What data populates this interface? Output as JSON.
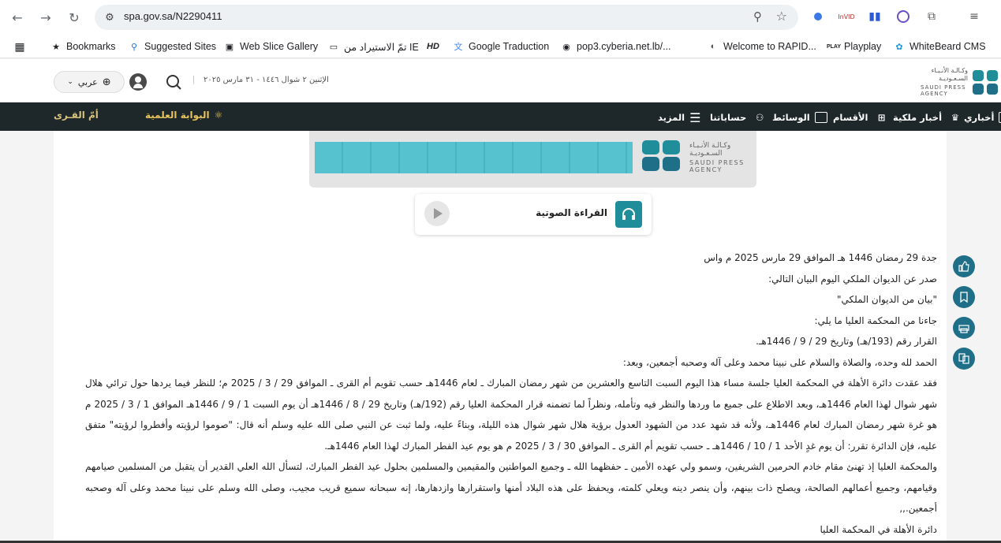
{
  "browser": {
    "url": "spa.gov.sa/N2290411",
    "bookmarks": [
      {
        "label": "Bookmarks",
        "icon": "star-icon"
      },
      {
        "label": "Suggested Sites",
        "icon": "search-icon"
      },
      {
        "label": "Web Slice Gallery",
        "icon": "web-slice-icon"
      },
      {
        "label": "تمّ الاستيراد من IE",
        "icon": "folder-icon"
      },
      {
        "label": "HD",
        "icon": "hd-icon"
      },
      {
        "label": "Google Traduction",
        "icon": "translate-icon"
      },
      {
        "label": "pop3.cyberia.net.lb/...",
        "icon": "globe-icon"
      },
      {
        "label": "Welcome to RAPID...",
        "icon": "rapid-icon"
      },
      {
        "label": "Playplay",
        "icon": "playplay-icon"
      },
      {
        "label": "WhiteBeard CMS",
        "icon": "whitebeard-icon"
      }
    ]
  },
  "header": {
    "language": "عربي",
    "date": "الإثنين ٢ شوال ١٤٤٦ - ٣١ مارس ٢٠٢٥",
    "logo_ar": "وكـالـة الأنـبـاء السـعـوديـة",
    "logo_en": "SAUDI PRESS AGENCY"
  },
  "nav": {
    "items": [
      {
        "label": "أخباري"
      },
      {
        "label": "أخبار ملكية"
      },
      {
        "label": "الأقسام"
      },
      {
        "label": "الوسائط"
      },
      {
        "label": "حساباتنا"
      },
      {
        "label": "المزيد"
      }
    ],
    "science_portal": "البوابة العلمية",
    "umm_al_qura": "أمّ القـرى"
  },
  "audio": {
    "label": "القراءة الصوتية"
  },
  "article": {
    "lines": [
      "جدة 29 رمضان 1446 هـ الموافق 29 مارس 2025 م واس",
      "صدر عن الديوان الملكي اليوم البيان التالي:",
      "\"بيان من الديوان الملكي\"",
      "جاءنا من المحكمة العليا ما يلي:",
      "القرار رقم (193/هـ) وتاريخ 29 / 9 / 1446هـ.",
      "الحمد لله وحده، والصلاة والسلام على نبينا محمد وعلى آله وصحبه أجمعين، وبعد:",
      "فقد عقدت دائرة الأهلة في المحكمة العليا جلسة مساء هذا اليوم السبت التاسع والعشرين من شهر رمضان المبارك ـ لعام 1446هـ حسب تقويم أم القرى ـ الموافق 29 / 3 / 2025 م؛ للنظر فيما يردها حول ترائي هلال شهر شوال لهذا العام 1446هـ، وبعد الاطلاع على جميع ما وردها والنظر فيه وتأمله، ونظراً لما تضمنه قرار المحكمة العليا رقم (192/هـ) وتاريخ 29 / 8 / 1446هـ أن يوم السبت 1 / 9 / 1446هـ الموافق 1 / 3 / 2025 م هو غرة شهر رمضان المبارك لعام 1446هـ، ولأنه قد شهد عدد من الشهود العدول برؤية هلال شهر شوال هذه الليلة، وبناءً عليه، ولما ثبت عن النبي صلى الله عليه وسلم أنه قال: \"صوموا لرؤيته وأفطروا لرؤيته\" متفق عليه، فإن الدائرة تقرر: أن يوم غدٍ الأحد 1 / 10 / 1446هـ ـ حسب تقويم أم القرى ـ الموافق 30 / 3 / 2025 م هو يوم عيد الفطر المبارك لهذا العام 1446هـ.",
      "والمحكمة العليا إذ تهنئ مقام خادم الحرمين الشريفين، وسمو ولي عهده الأمين ـ حفظهما الله ـ وجميع المواطنين والمقيمين والمسلمين بحلول عيد الفطر المبارك، لتسأل الله العلي القدير أن يتقبل من المسلمين صيامهم وقيامهم، وجميع أعمالهم الصالحة، ويصلح ذات بينهم، وأن ينصر دينه ويعلي كلمته، ويحفظ على هذه البلاد أمنها واستقرارها وازدهارها، إنه سبحانه سميع قريب مجيب، وصلى الله وسلم على نبينا محمد وعلى آله وصحبه أجمعين.,,",
      "دائرة الأهلة في المحكمة العليا"
    ]
  },
  "colors": {
    "navbar": "#1e2729",
    "accent": "#1e6f87",
    "teal": "#1f8e9a",
    "banner_teal": "#56c2cf"
  }
}
